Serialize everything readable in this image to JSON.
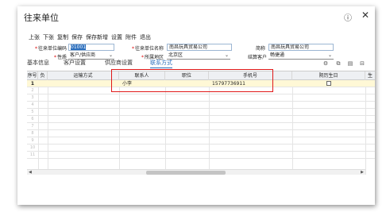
{
  "window": {
    "title": "往来单位",
    "help_icon": "help-circle-icon",
    "close_icon": "close-icon"
  },
  "toolbar": {
    "items": [
      "上张",
      "下张",
      "复制",
      "保存",
      "保存新增",
      "设置",
      "附件",
      "退出"
    ]
  },
  "form": {
    "code_label": "往来单位编码",
    "code_value": "01001",
    "name_label": "往来单位名称",
    "name_value": "南昌玩具贸易公司",
    "short_label": "简称",
    "short_value": "南昌玩具贸易公司",
    "nature_label": "性质",
    "nature_value": "客户/供应商",
    "region_label": "所属地区",
    "region_value": "北京区",
    "settle_label": "结算客户",
    "settle_value": "畅捷通"
  },
  "tabs": {
    "items": [
      "基本信息",
      "客户设置",
      "供应商设置",
      "联系方式"
    ],
    "active_index": 3
  },
  "grid": {
    "columns": [
      "序号",
      "负",
      "运输方式",
      "联系人",
      "职位",
      "手机号",
      "阴历生日",
      "生"
    ],
    "rows": [
      {
        "index": "1",
        "flag": "",
        "transport": "",
        "contact": "小李",
        "position": "",
        "mobile": "15797736911",
        "lunar_birthday": ""
      }
    ],
    "row_numbers": [
      "2",
      "3",
      "4",
      "5",
      "6",
      "7",
      "8",
      "9",
      "10",
      "11"
    ]
  }
}
